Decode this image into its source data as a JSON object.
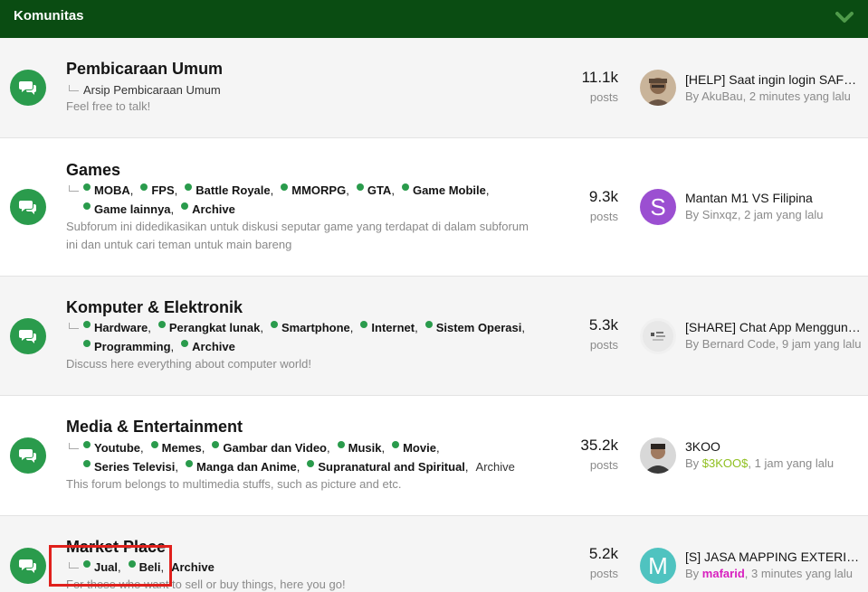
{
  "header": {
    "title": "Komunitas",
    "collapse_icon": "chevron-down-icon",
    "background": "#0a4c12"
  },
  "nodes": [
    {
      "title": "Pembicaraan Umum",
      "subforums": [
        "Arsip Pembicaraan Umum"
      ],
      "description": "Feel free to talk!",
      "stat_value": "11.1k",
      "stat_label": "posts",
      "last_post": {
        "title": "[HELP] Saat ingin login SAFD ...",
        "by": "By",
        "user": "AkuBau",
        "sep": ",",
        "time": "2 minutes yang lalu"
      }
    },
    {
      "title": "Games",
      "subforums": [
        "MOBA",
        "FPS",
        "Battle Royale",
        "MMORPG",
        "GTA",
        "Game Mobile",
        "Game lainnya",
        "Archive"
      ],
      "description": "Subforum ini didedikasikan untuk diskusi seputar game yang terdapat di dalam subforum ini dan untuk cari teman untuk main bareng",
      "stat_value": "9.3k",
      "stat_label": "posts",
      "last_post": {
        "title": "Mantan M1 VS Filipina",
        "avatar_letter": "S",
        "avatar_color": "#9b4fd1",
        "by": "By",
        "user": "Sinxqz",
        "sep": ",",
        "time": "2 jam yang lalu"
      }
    },
    {
      "title": "Komputer & Elektronik",
      "subforums": [
        "Hardware",
        "Perangkat lunak",
        "Smartphone",
        "Internet",
        "Sistem Operasi",
        "Programming",
        "Archive"
      ],
      "description": "Discuss here everything about computer world!",
      "stat_value": "5.3k",
      "stat_label": "posts",
      "last_post": {
        "title": "[SHARE] Chat App Mengguna...",
        "by": "By",
        "user": "Bernard Code",
        "sep": ",",
        "time": "9 jam yang lalu"
      }
    },
    {
      "title": "Media & Entertainment",
      "subforums": [
        "Youtube",
        "Memes",
        "Gambar dan Video",
        "Musik",
        "Movie",
        "Series Televisi",
        "Manga dan Anime",
        "Supranatural and Spiritual",
        "Archive"
      ],
      "description": "This forum belongs to multimedia stuffs, such as picture and etc.",
      "stat_value": "35.2k",
      "stat_label": "posts",
      "last_post": {
        "title": "3KOO",
        "by": "By",
        "user": "$3KOO$",
        "user_color": "#8fbf1f",
        "sep": ",",
        "time": "1 jam yang lalu"
      }
    },
    {
      "title": "Market Place",
      "subforums": [
        "Jual",
        "Beli",
        "Archive"
      ],
      "description": "For those who want to sell or buy things, here you go!",
      "stat_value": "5.2k",
      "stat_label": "posts",
      "last_post": {
        "title": "[S] JASA MAPPING EXTERIOR ...",
        "avatar_letter": "M",
        "avatar_color": "#4fc3c0",
        "by": "By",
        "user": "mafarid",
        "user_color": "#d81fbf",
        "sep": ",",
        "time": "3 minutes yang lalu"
      }
    }
  ],
  "punct": {
    "comma": ","
  },
  "colors": {
    "node_icon": "#2a9b4c",
    "highlight": "#e0201c"
  },
  "node_icon_name": "chat-bubbles-icon"
}
